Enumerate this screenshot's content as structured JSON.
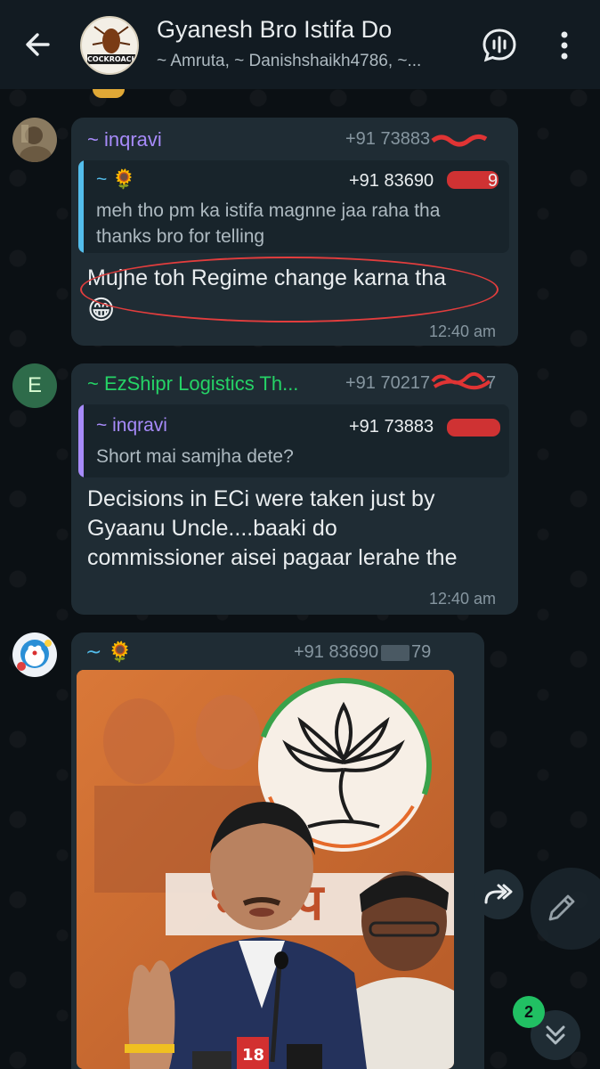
{
  "header": {
    "title": "Gyanesh Bro Istifa Do",
    "subtitle": "~ Amruta, ~ Danishshaikh4786, ~...",
    "group_logo_text": "COCKROACH"
  },
  "messages": [
    {
      "sender": "~ inqravi",
      "phone": "+91 73883",
      "sender_color": "#a78bfa",
      "quote": {
        "name": "~ 🌻",
        "phone": "+91 83690",
        "phone_suffix": "9",
        "text": "meh tho pm ka istifa  magnne jaa raha tha thanks bro for telling",
        "bar_color": "#53bdeb"
      },
      "text": "Mujhe toh Regime change karna tha",
      "emoji": "😁",
      "time": "12:40 am"
    },
    {
      "sender": "~ EzShipr Logistics Th...",
      "phone": "+91 70217",
      "phone_suffix": "7",
      "sender_color": "#25d366",
      "avatar_letter": "E",
      "quote": {
        "name": "~ inqravi",
        "phone": "+91 73883",
        "text": "Short mai samjha dete?",
        "bar_color": "#a78bfa"
      },
      "text": "Decisions in ECi were taken just by Gyaanu Uncle....baaki do commissioner aisei pagaar lerahe the",
      "time": "12:40 am"
    },
    {
      "sender": "~ 🌻",
      "phone": "+91 83690",
      "phone_suffix": "79",
      "sender_color": "#53bdeb",
      "photo_caption_text": "भाजप",
      "photo_podium_text": "18"
    }
  ],
  "unread_badge": "2",
  "colors": {
    "header_bg": "#121b22",
    "bubble_bg": "#1f2c34",
    "accent": "#21c063",
    "annotation_red": "#e23d3d"
  },
  "icons": [
    "back-arrow-icon",
    "voice-chat-icon",
    "more-vert-icon",
    "forward-icon",
    "pencil-icon",
    "chevron-double-down-icon"
  ]
}
